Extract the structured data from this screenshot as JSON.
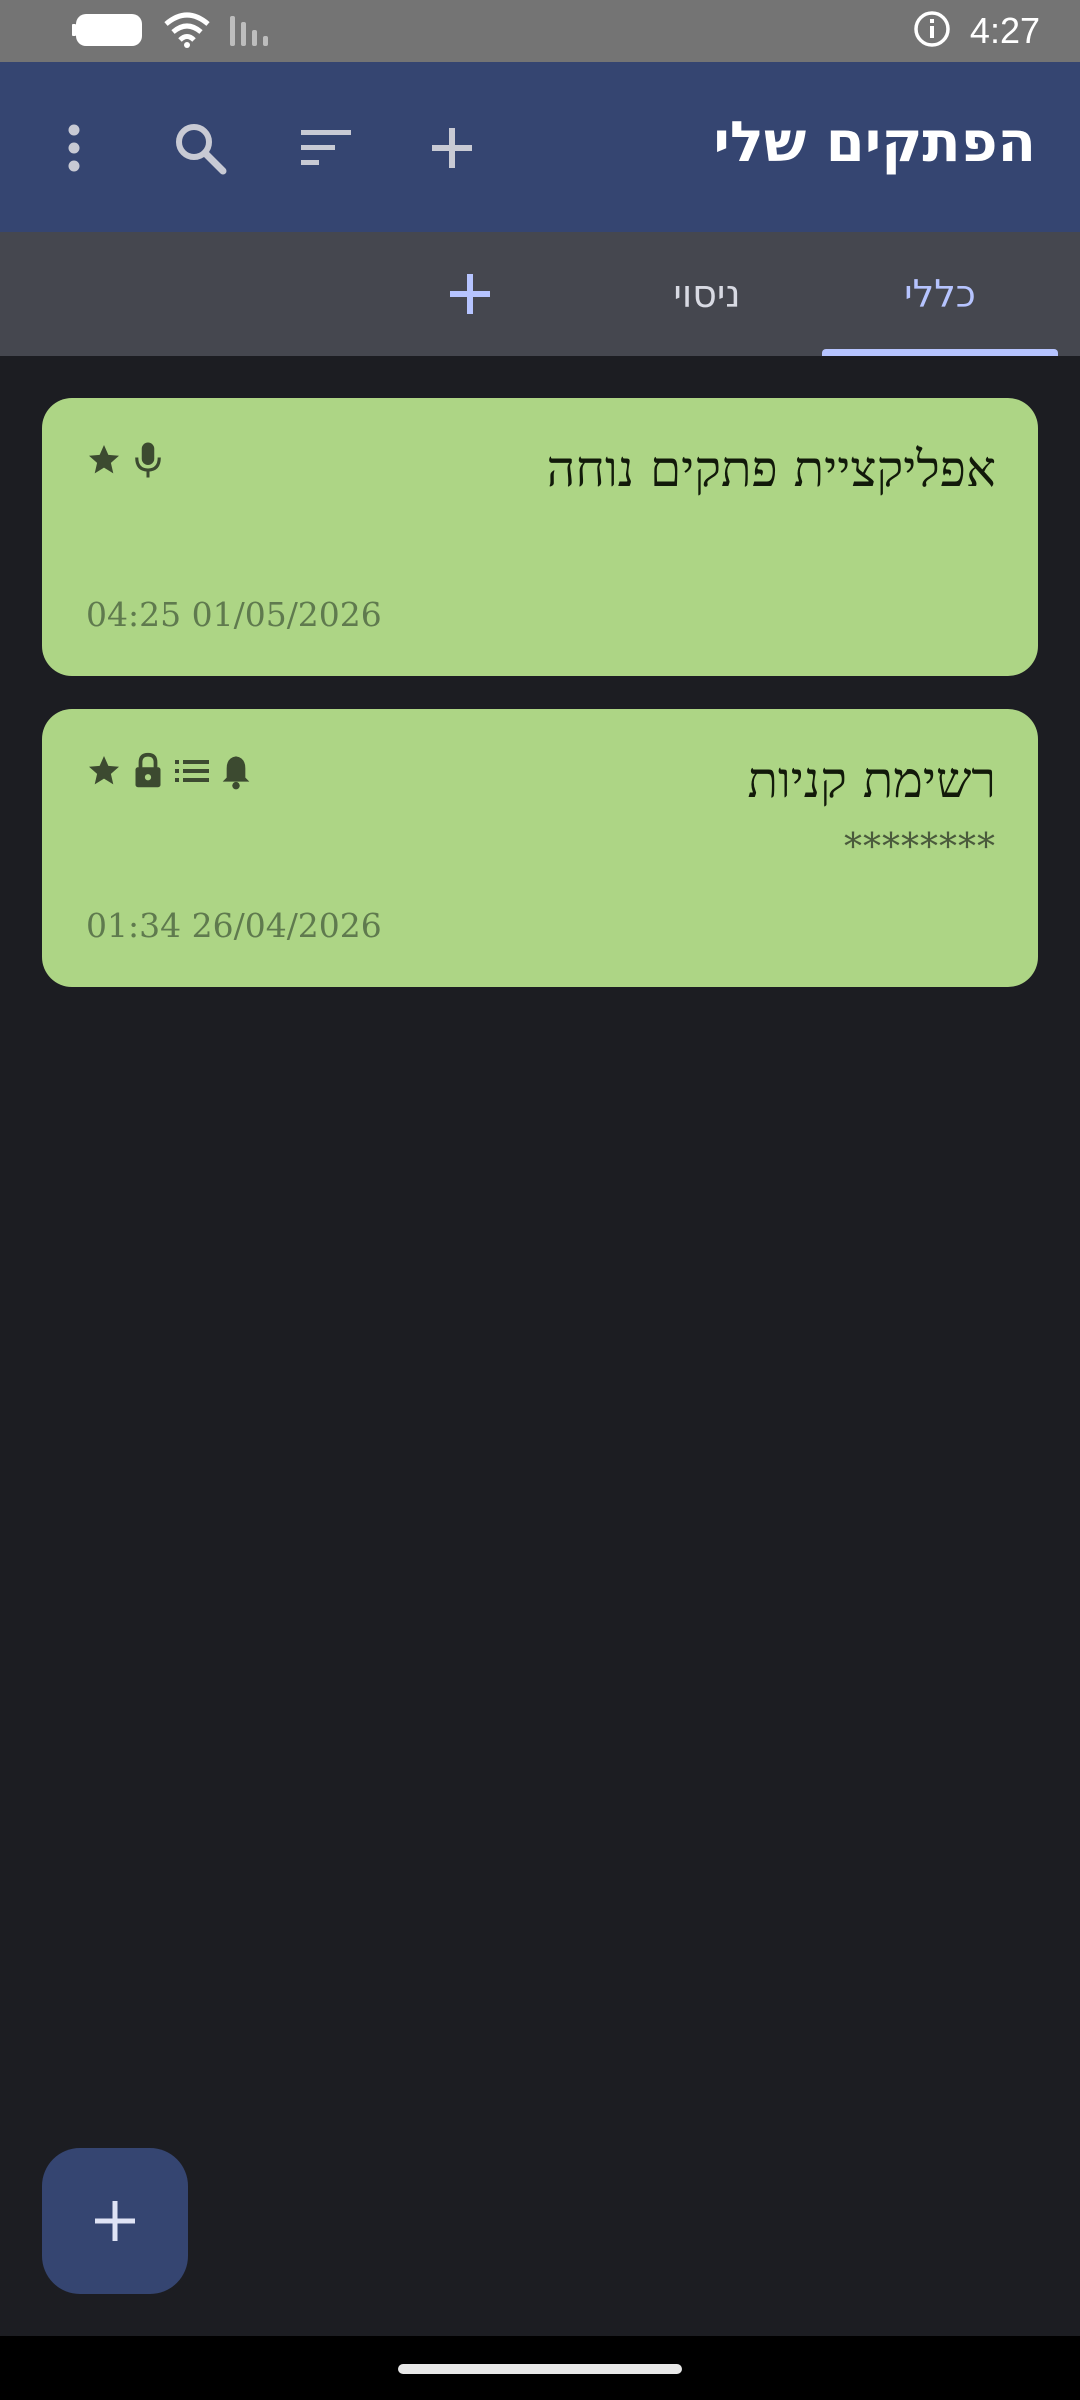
{
  "status_bar": {
    "time": "4:27",
    "icons": [
      "battery-icon",
      "wifi-icon",
      "signal-icon",
      "info-icon"
    ]
  },
  "app_bar": {
    "title": "הפתקים שלי",
    "actions": [
      "more-vert-icon",
      "search-icon",
      "sort-icon",
      "add-icon"
    ]
  },
  "tabs": [
    {
      "label": "כללי",
      "selected": true
    },
    {
      "label": "ניסוי",
      "selected": false
    }
  ],
  "notes": [
    {
      "title": "אפליקציית פתקים נוחה",
      "preview": "",
      "date": "04:25 01/05/2026",
      "icons": [
        "star-icon",
        "mic-icon"
      ]
    },
    {
      "title": "רשימת קניות",
      "preview": "********",
      "date": "01:34 26/04/2026",
      "icons": [
        "star-icon",
        "lock-icon",
        "list-icon",
        "bell-icon"
      ]
    }
  ],
  "colors": {
    "app_bar": "#354571",
    "tab_bar": "#45474f",
    "background": "#1c1d22",
    "card": "#add585",
    "accent": "#b6c4ff"
  }
}
